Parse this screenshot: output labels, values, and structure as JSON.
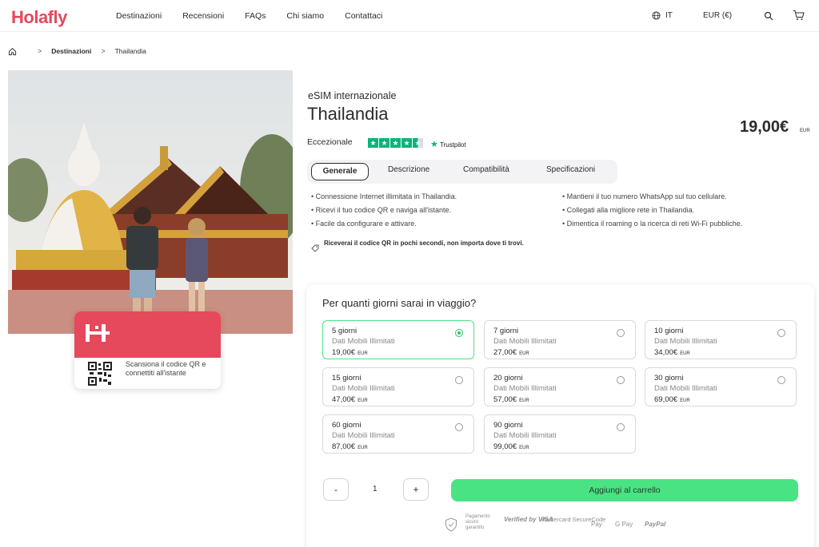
{
  "header": {
    "logo": "Holafly",
    "nav": [
      "Destinazioni",
      "Recensioni",
      "FAQs",
      "Chi siamo",
      "Contattaci"
    ],
    "language": "IT",
    "currency": "EUR (€)"
  },
  "breadcrumb": {
    "destinations": "Destinazioni",
    "current": "Thailandia"
  },
  "qr_card": {
    "text": "Scansiona il codice QR e connettiti all'istante"
  },
  "product": {
    "subtitle": "eSIM internazionale",
    "title": "Thailandia",
    "price": "19,00€",
    "price_currency": "EUR",
    "rating_label": "Eccezionale",
    "trustpilot": "Trustpilot",
    "stars": 4.5
  },
  "tabs": [
    "Generale",
    "Descrizione",
    "Compatibilità",
    "Specificazioni"
  ],
  "features_left": [
    "Connessione Internet illimitata in Thailandia.",
    "Ricevi il tuo codice QR e naviga all'istante.",
    "Facile da configurare e attivare."
  ],
  "features_right": [
    "Mantieni il tuo numero WhatsApp sul tuo cellulare.",
    "Collegati alla migliore rete in Thailandia.",
    "Dimentica il roaming o la ricerca di reti Wi-Fi pubbliche."
  ],
  "instant_note": "Riceverai il codice QR in pochi secondi, non importa dove ti trovi.",
  "plans": {
    "question": "Per quanti giorni sarai in viaggio?",
    "data_label": "Dati Mobili Illimitati",
    "currency": "EUR",
    "items": [
      {
        "days": "5 giorni",
        "price": "19,00€",
        "selected": true
      },
      {
        "days": "7 giorni",
        "price": "27,00€",
        "selected": false
      },
      {
        "days": "10 giorni",
        "price": "34,00€",
        "selected": false
      },
      {
        "days": "15 giorni",
        "price": "47,00€",
        "selected": false
      },
      {
        "days": "20 giorni",
        "price": "57,00€",
        "selected": false
      },
      {
        "days": "30 giorni",
        "price": "69,00€",
        "selected": false
      },
      {
        "days": "60 giorni",
        "price": "87,00€",
        "selected": false
      },
      {
        "days": "90 giorni",
        "price": "99,00€",
        "selected": false
      }
    ]
  },
  "cart": {
    "minus": "-",
    "quantity": "1",
    "plus": "+",
    "add_label": "Aggiungi al carrello"
  },
  "payments": {
    "secure": "Pagamento sicuro garantito",
    "visa": "Verified by VISA",
    "mastercard": "Mastercard SecureCode",
    "applepay": " Pay",
    "googlepay": "G Pay",
    "paypal": "PayPal"
  },
  "colors": {
    "brand": "#e6485c",
    "accent_green": "#4ae383",
    "trustpilot_green": "#00b67a"
  }
}
